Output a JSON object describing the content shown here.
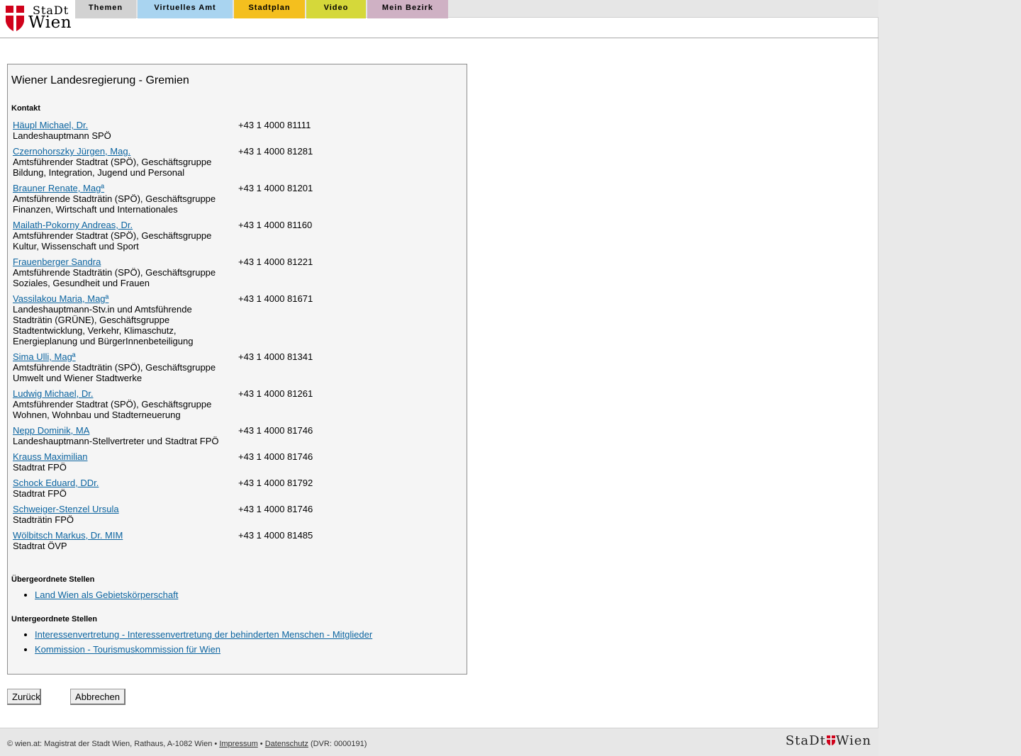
{
  "header": {
    "logo": {
      "line1": "StaDt",
      "line2": "Wien"
    },
    "tabs": [
      {
        "label": "Themen",
        "color": "#d2d2d2"
      },
      {
        "label": "Virtuelles Amt",
        "color": "#a9d4f0"
      },
      {
        "label": "Stadtplan",
        "color": "#f4bf1e"
      },
      {
        "label": "Video",
        "color": "#d5d83a"
      },
      {
        "label": "Mein Bezirk",
        "color": "#cfb1c4"
      }
    ]
  },
  "main": {
    "title": "Wiener Landesregierung - Gremien",
    "contact_title": "Kontakt",
    "contacts": [
      {
        "name": "Häupl Michael, Dr.",
        "role": "Landeshauptmann SPÖ",
        "phone": "+43 1 4000 81111"
      },
      {
        "name": "Czernohorszky Jürgen, Mag.",
        "role": "Amtsführender Stadtrat (SPÖ), Geschäftsgruppe Bildung, Integration, Jugend und Personal",
        "phone": "+43 1 4000 81281"
      },
      {
        "name": "Brauner Renate, Magª",
        "role": "Amtsführende Stadträtin (SPÖ), Geschäftsgruppe Finanzen, Wirtschaft und Internationales",
        "phone": "+43 1 4000 81201"
      },
      {
        "name": "Mailath-Pokorny Andreas, Dr.",
        "role": "Amtsführender Stadtrat (SPÖ), Geschäftsgruppe Kultur, Wissenschaft und Sport",
        "phone": "+43 1 4000 81160"
      },
      {
        "name": "Frauenberger Sandra",
        "role": "Amtsführende Stadträtin (SPÖ), Geschäftsgruppe Soziales, Gesundheit und Frauen",
        "phone": "+43 1 4000 81221"
      },
      {
        "name": "Vassilakou Maria, Magª",
        "role": "Landeshauptmann-Stv.in und Amtsführende Stadträtin (GRÜNE), Geschäftsgruppe Stadtentwicklung, Verkehr, Klimaschutz, Energieplanung und BürgerInnenbeteiligung",
        "phone": "+43 1 4000 81671"
      },
      {
        "name": "Sima Ulli, Magª",
        "role": "Amtsführende Stadträtin (SPÖ), Geschäftsgruppe Umwelt und Wiener Stadtwerke",
        "phone": "+43 1 4000 81341"
      },
      {
        "name": "Ludwig Michael, Dr.",
        "role": "Amtsführender Stadtrat (SPÖ), Geschäftsgruppe Wohnen, Wohnbau und Stadterneuerung",
        "phone": "+43 1 4000 81261"
      },
      {
        "name": "Nepp Dominik, MA",
        "role": "Landeshauptmann-Stellvertreter und Stadtrat FPÖ",
        "phone": "+43 1 4000 81746"
      },
      {
        "name": "Krauss Maximilian",
        "role": "Stadtrat FPÖ",
        "phone": "+43 1 4000 81746"
      },
      {
        "name": "Schock Eduard, DDr.",
        "role": "Stadtrat FPÖ",
        "phone": "+43 1 4000 81792"
      },
      {
        "name": "Schweiger-Stenzel Ursula",
        "role": "Stadträtin FPÖ",
        "phone": "+43 1 4000 81746"
      },
      {
        "name": "Wölbitsch Markus, Dr. MIM",
        "role": "Stadtrat ÖVP",
        "phone": "+43 1 4000 81485"
      }
    ],
    "parent_title": "Übergeordnete Stellen",
    "parents": [
      "Land Wien als Gebietskörperschaft"
    ],
    "children_title": "Untergeordnete Stellen",
    "children": [
      "Interessenvertretung - Interessenvertretung der behinderten Menschen - Mitglieder",
      "Kommission - Tourismuskommission für Wien"
    ]
  },
  "buttons": {
    "back": "Zurück",
    "cancel": "Abbrechen"
  },
  "footer": {
    "prefix": "© wien.at: Magistrat der Stadt Wien, Rathaus, A-1082 Wien •",
    "impressum": "Impressum",
    "sep": "•",
    "datenschutz": "Datenschutz",
    "dvr": "(DVR: 0000191)",
    "logo_left": "StaDt",
    "logo_right": "Wien"
  }
}
